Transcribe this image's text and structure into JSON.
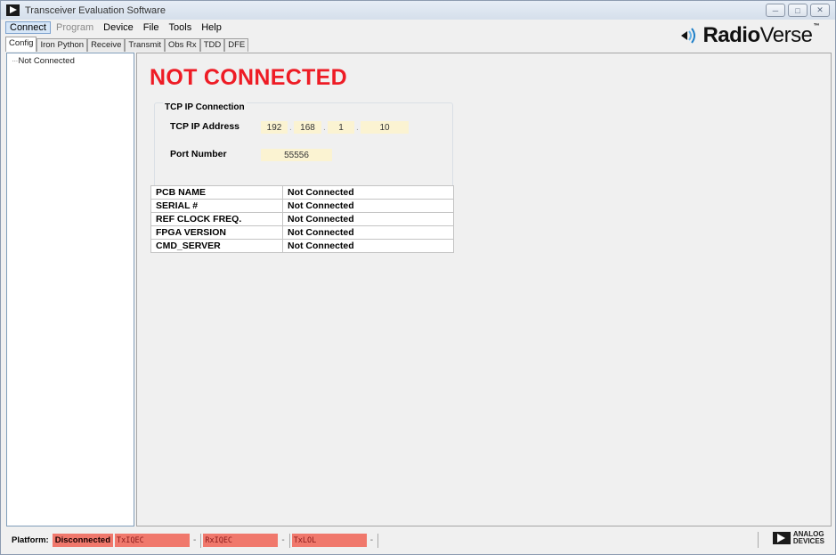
{
  "window": {
    "title": "Transceiver Evaluation Software",
    "controls": [
      "minimize",
      "maximize",
      "close"
    ]
  },
  "menu": {
    "items": [
      {
        "label": "Connect",
        "state": "active"
      },
      {
        "label": "Program",
        "state": "disabled"
      },
      {
        "label": "Device",
        "state": "normal"
      },
      {
        "label": "File",
        "state": "normal"
      },
      {
        "label": "Tools",
        "state": "normal"
      },
      {
        "label": "Help",
        "state": "normal"
      }
    ]
  },
  "tabs": [
    {
      "label": "Config",
      "active": true
    },
    {
      "label": "Iron Python",
      "active": false
    },
    {
      "label": "Receive",
      "active": false
    },
    {
      "label": "Transmit",
      "active": false
    },
    {
      "label": "Obs Rx",
      "active": false
    },
    {
      "label": "TDD",
      "active": false
    },
    {
      "label": "DFE",
      "active": false
    }
  ],
  "brand": {
    "logo_bold": "Radio",
    "logo_light": "Verse",
    "tm": "™"
  },
  "tree": {
    "items": [
      "Not Connected"
    ]
  },
  "main": {
    "status_heading": "NOT CONNECTED",
    "tcp_group": {
      "title": "TCP IP Connection",
      "ip_label": "TCP IP Address",
      "ip_octets": [
        "192",
        "168",
        "1",
        "10"
      ],
      "port_label": "Port Number",
      "port_value": "55556"
    },
    "info_table": [
      {
        "key": "PCB NAME",
        "value": "Not Connected"
      },
      {
        "key": "SERIAL #",
        "value": "Not Connected"
      },
      {
        "key": "REF CLOCK FREQ.",
        "value": "Not Connected"
      },
      {
        "key": "FPGA VERSION",
        "value": "Not Connected"
      },
      {
        "key": "CMD_SERVER",
        "value": "Not Connected"
      }
    ]
  },
  "statusbar": {
    "platform_label": "Platform:",
    "platform_status": "Disconnected",
    "calibrations": [
      {
        "name": "TxIQEC",
        "value": "-"
      },
      {
        "name": "RxIQEC",
        "value": "-"
      },
      {
        "name": "TxLOL",
        "value": "-"
      }
    ],
    "vendor_line1": "ANALOG",
    "vendor_line2": "DEVICES"
  },
  "colors": {
    "alert_red": "#ee1c25",
    "status_salmon": "#f0786c",
    "field_yellow": "#fbf3d2"
  }
}
